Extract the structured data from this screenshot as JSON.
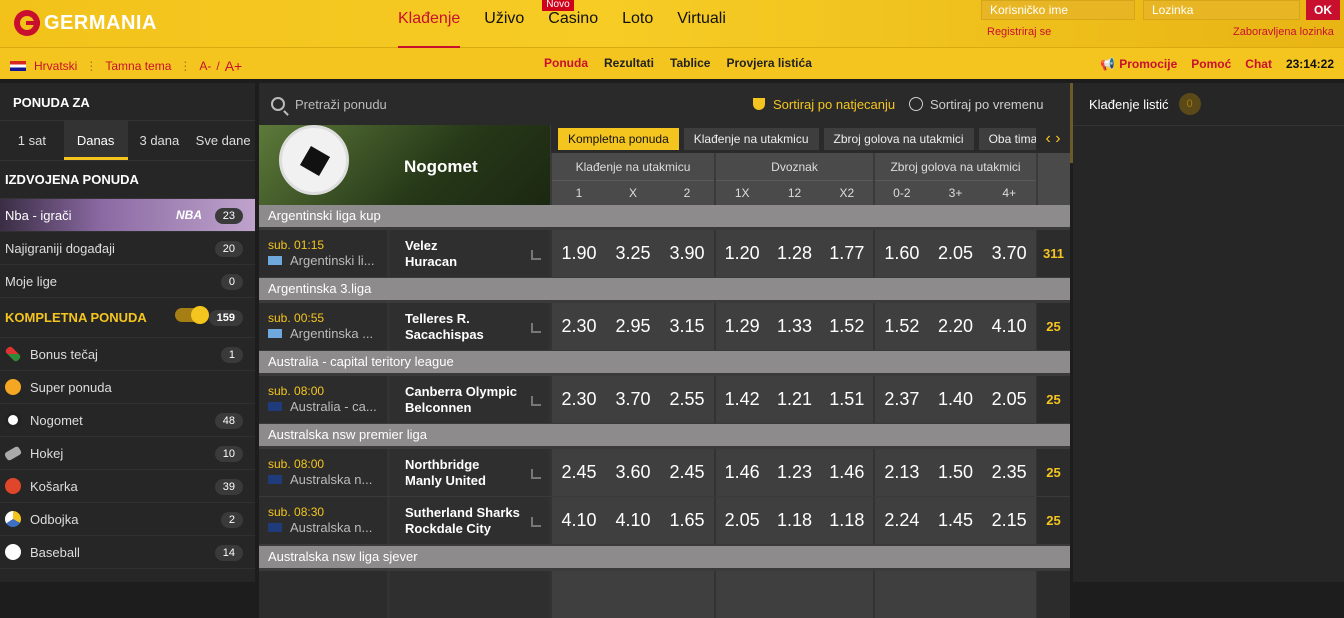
{
  "header": {
    "logo": "GERMANIA",
    "nav": [
      "Klađenje",
      "Uživo",
      "Casino",
      "Loto",
      "Virtuali"
    ],
    "novo_badge": "Novo",
    "username_placeholder": "Korisničko ime",
    "password_placeholder": "Lozinka",
    "ok_label": "OK",
    "register": "Registriraj se",
    "forgot": "Zaboravljena lozinka"
  },
  "subbar": {
    "language": "Hrvatski",
    "theme": "Tamna tema",
    "font_small": "A-",
    "font_sep": "/",
    "font_big": "A+",
    "links": [
      "Ponuda",
      "Rezultati",
      "Tablice",
      "Provjera listića"
    ],
    "right": [
      "Promocije",
      "Pomoć",
      "Chat"
    ],
    "clock": "23:14:22"
  },
  "sidebar": {
    "title": "PONUDA ZA",
    "tabs": [
      "1 sat",
      "Danas",
      "3 dana",
      "Sve dane"
    ],
    "featured_title": "IZDVOJENA PONUDA",
    "featured": [
      {
        "label": "Nba - igrači",
        "count": "23"
      },
      {
        "label": "Najigraniji događaji",
        "count": "20"
      },
      {
        "label": "Moje lige",
        "count": "0"
      }
    ],
    "full_title": "KOMPLETNA PONUDA",
    "full_count": "159",
    "sports": [
      {
        "label": "Bonus tečaj",
        "count": "1"
      },
      {
        "label": "Super ponuda",
        "count": ""
      },
      {
        "label": "Nogomet",
        "count": "48"
      },
      {
        "label": "Hokej",
        "count": "10"
      },
      {
        "label": "Košarka",
        "count": "39"
      },
      {
        "label": "Odbojka",
        "count": "2"
      },
      {
        "label": "Baseball",
        "count": "14"
      }
    ]
  },
  "main": {
    "search_placeholder": "Pretraži ponudu",
    "sort_competition": "Sortiraj po natjecanju",
    "sort_time": "Sortiraj po vremenu",
    "sport_title": "Nogomet",
    "market_tabs": [
      "Kompletna ponuda",
      "Klađenje na utakmicu",
      "Zbroj golova na utakmici",
      "Oba tima ..."
    ],
    "columns": [
      {
        "title": "Klađenje na utakmicu",
        "subs": [
          "1",
          "X",
          "2"
        ]
      },
      {
        "title": "Dvoznak",
        "subs": [
          "1X",
          "12",
          "X2"
        ]
      },
      {
        "title": "Zbroj golova na utakmici",
        "subs": [
          "0-2",
          "3+",
          "4+"
        ]
      }
    ],
    "leagues": [
      {
        "name": "Argentinski liga kup"
      },
      {
        "name": "Argentinska 3.liga"
      },
      {
        "name": "Australia - capital teritory league"
      },
      {
        "name": "Australska nsw premier liga"
      },
      {
        "name": "Australska nsw liga sjever"
      }
    ],
    "matches": [
      {
        "time": "sub. 01:15",
        "league": "Argentinski li...",
        "home": "Velez",
        "away": "Huracan",
        "odds": [
          "1.90",
          "3.25",
          "3.90",
          "1.20",
          "1.28",
          "1.77",
          "1.60",
          "2.05",
          "3.70"
        ],
        "more": "311"
      },
      {
        "time": "sub. 00:55",
        "league": "Argentinska ...",
        "home": "Telleres R.",
        "away": "Sacachispas",
        "odds": [
          "2.30",
          "2.95",
          "3.15",
          "1.29",
          "1.33",
          "1.52",
          "1.52",
          "2.20",
          "4.10"
        ],
        "more": "25"
      },
      {
        "time": "sub. 08:00",
        "league": "Australia - ca...",
        "home": "Canberra Olympic",
        "away": "Belconnen",
        "odds": [
          "2.30",
          "3.70",
          "2.55",
          "1.42",
          "1.21",
          "1.51",
          "2.37",
          "1.40",
          "2.05"
        ],
        "more": "25"
      },
      {
        "time": "sub. 08:00",
        "league": "Australska n...",
        "home": "Northbridge",
        "away": "Manly United",
        "odds": [
          "2.45",
          "3.60",
          "2.45",
          "1.46",
          "1.23",
          "1.46",
          "2.13",
          "1.50",
          "2.35"
        ],
        "more": "25"
      },
      {
        "time": "sub. 08:30",
        "league": "Australska n...",
        "home": "Sutherland Sharks",
        "away": "Rockdale City",
        "odds": [
          "4.10",
          "4.10",
          "1.65",
          "2.05",
          "1.18",
          "1.18",
          "2.24",
          "1.45",
          "2.15"
        ],
        "more": "25"
      }
    ]
  },
  "slip": {
    "title": "Klađenje listić",
    "count": "0"
  }
}
